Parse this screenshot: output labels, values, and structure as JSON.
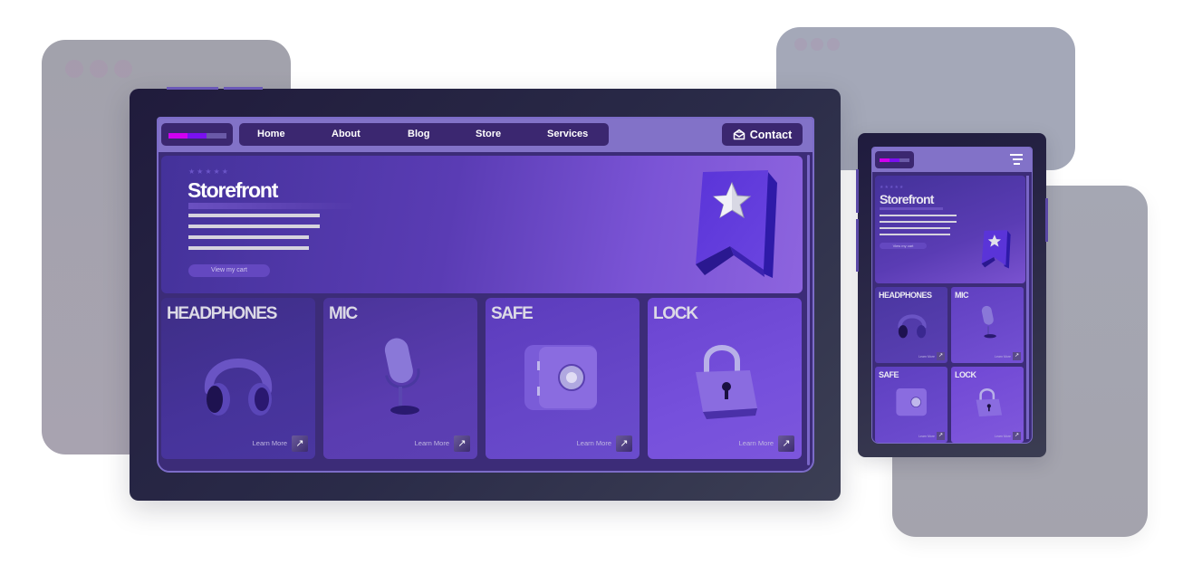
{
  "desktop": {
    "nav": {
      "links": [
        "Home",
        "About",
        "Blog",
        "Store",
        "Services"
      ],
      "contact_label": "Contact",
      "contact_icon": "envelope-open-icon",
      "logo_colors": [
        "#d000f0",
        "#7a10f0",
        "#6a5aa8"
      ]
    },
    "hero": {
      "rating_stars": "★★★★★",
      "title": "Storefront",
      "cart_button": "View my cart",
      "hero_icon": "bookmark-star-icon"
    },
    "products": [
      {
        "title": "HEADPHONES",
        "link": "Learn More",
        "icon": "headphones-icon"
      },
      {
        "title": "MIC",
        "link": "Learn More",
        "icon": "microphone-icon"
      },
      {
        "title": "SAFE",
        "link": "Learn More",
        "icon": "safe-icon"
      },
      {
        "title": "LOCK",
        "link": "Learn More",
        "icon": "padlock-icon"
      }
    ],
    "arrow_glyph": "↗"
  },
  "tablet": {
    "menu_icon": "hamburger-menu-icon",
    "hero": {
      "rating_stars": "★★★★★",
      "title": "Storefront",
      "cart_button": "View my cart"
    },
    "products": [
      {
        "title": "HEADPHONES",
        "link": "Learn More"
      },
      {
        "title": "MIC",
        "link": "Learn More"
      },
      {
        "title": "SAFE",
        "link": "Learn More"
      },
      {
        "title": "LOCK",
        "link": "Learn More"
      }
    ],
    "arrow_glyph": "↗"
  },
  "colors": {
    "accent": "#8272c8",
    "nav_bg": "#3b2770",
    "device_frame": "#201b3c",
    "background_window": "#a4a6b2"
  }
}
